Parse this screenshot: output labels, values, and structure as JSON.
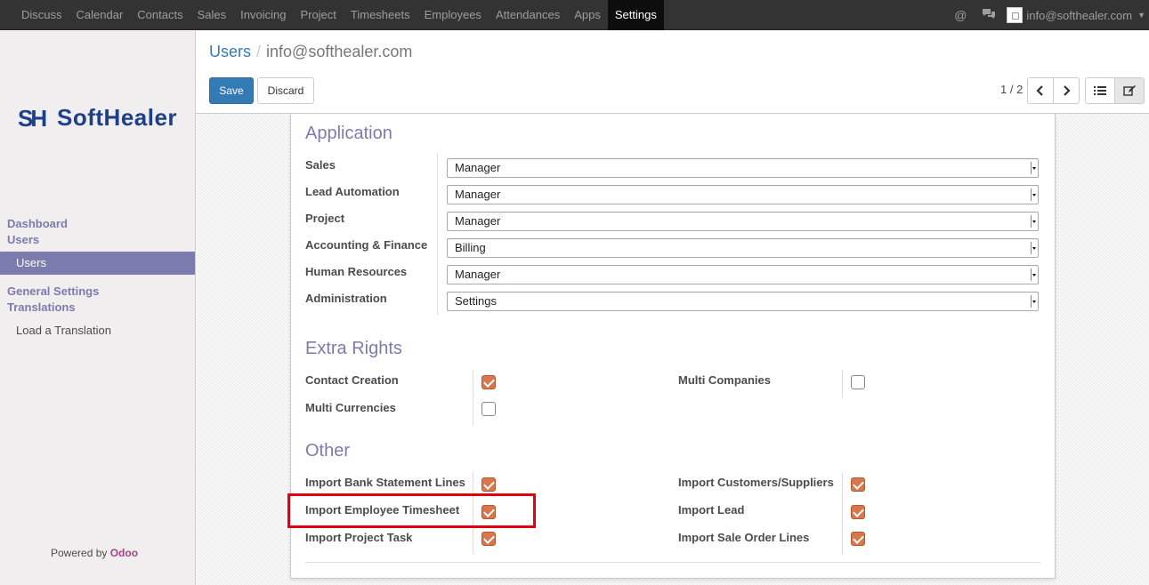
{
  "topbar": {
    "menu": [
      "Discuss",
      "Calendar",
      "Contacts",
      "Sales",
      "Invoicing",
      "Project",
      "Timesheets",
      "Employees",
      "Attendances",
      "Apps",
      "Settings"
    ],
    "active_menu": "Settings",
    "user_email": "info@softhealer.com"
  },
  "sidebar": {
    "logo_text": "SoftHealer",
    "logo_mark": "SH",
    "dashboard": "Dashboard",
    "users_head": "Users",
    "users_item": "Users",
    "general_settings": "General Settings",
    "translations": "Translations",
    "load_translation": "Load a Translation",
    "powered_by": "Powered by",
    "powered_brand": "Odoo"
  },
  "header": {
    "breadcrumb_root": "Users",
    "breadcrumb_sep": "/",
    "breadcrumb_current": "info@softhealer.com",
    "save_label": "Save",
    "discard_label": "Discard",
    "pager": "1 / 2"
  },
  "application": {
    "title": "Application",
    "fields": [
      {
        "label": "Sales",
        "value": "Manager"
      },
      {
        "label": "Lead Automation",
        "value": "Manager"
      },
      {
        "label": "Project",
        "value": "Manager"
      },
      {
        "label": "Accounting & Finance",
        "value": "Billing"
      },
      {
        "label": "Human Resources",
        "value": "Manager"
      },
      {
        "label": "Administration",
        "value": "Settings"
      }
    ]
  },
  "extra_rights": {
    "title": "Extra Rights",
    "contact_creation": {
      "label": "Contact Creation",
      "checked": true
    },
    "multi_companies": {
      "label": "Multi Companies",
      "checked": false
    },
    "multi_currencies": {
      "label": "Multi Currencies",
      "checked": false
    }
  },
  "other": {
    "title": "Other",
    "import_bank": {
      "label": "Import Bank Statement Lines",
      "checked": true
    },
    "import_timesheet": {
      "label": "Import Employee Timesheet",
      "checked": true
    },
    "import_task": {
      "label": "Import Project Task",
      "checked": true
    },
    "import_customers": {
      "label": "Import Customers/Suppliers",
      "checked": true
    },
    "import_lead": {
      "label": "Import Lead",
      "checked": true
    },
    "import_sale": {
      "label": "Import Sale Order Lines",
      "checked": true
    }
  },
  "colors": {
    "navbar": "#333333",
    "accent": "#7c7bad",
    "primary": "#337ab7",
    "checkbox": "#d9764a",
    "highlight": "#e3000f"
  }
}
